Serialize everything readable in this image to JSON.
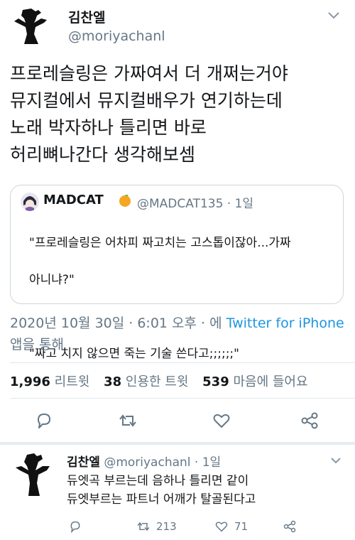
{
  "tweet": {
    "author": {
      "name": "김찬엘",
      "handle": "@moriyachanl"
    },
    "body_lines": [
      "프로레슬링은 가짜여서 더 개쩌는거야",
      "뮤지컬에서 뮤지컬배우가 연기하는데",
      "노래 박자하나 틀리면 바로",
      "허리뼈나간다 생각해보셈"
    ],
    "quote": {
      "name": "MADCAT",
      "meta": "@MADCAT135 · 1일",
      "body_line1": "\"프로레슬링은 어차피 짜고치는 고스톱이잖아...가짜",
      "body_line2": "아니냐?\"",
      "body_line3": "\"짜고 치지 않으면 죽는 기술 쓴다고;;;;;;\""
    },
    "timestamp_prefix": "2020년 10월 30일 · 6:01 오후 · 에 ",
    "timestamp_source": "Twitter for iPhone",
    "timestamp_suffix": " 앱을 통해",
    "stats": {
      "retweets_count": "1,996",
      "retweets_label": "리트윗",
      "quotes_count": "38",
      "quotes_label": "인용한 트윗",
      "likes_count": "539",
      "likes_label": "마음에 들어요"
    }
  },
  "reply": {
    "name": "김찬엘",
    "handle": "@moriyachanl",
    "time": "· 1일",
    "body_line1": "듀엣곡 부르는데 음하나 틀리면 같이",
    "body_line2": "듀엣부르는 파트너 어깨가 탈골된다고",
    "retweets": "213",
    "likes": "71"
  },
  "colors": {
    "link": "#1b95e0",
    "secondary": "#657786",
    "border": "#ccd6dd"
  }
}
